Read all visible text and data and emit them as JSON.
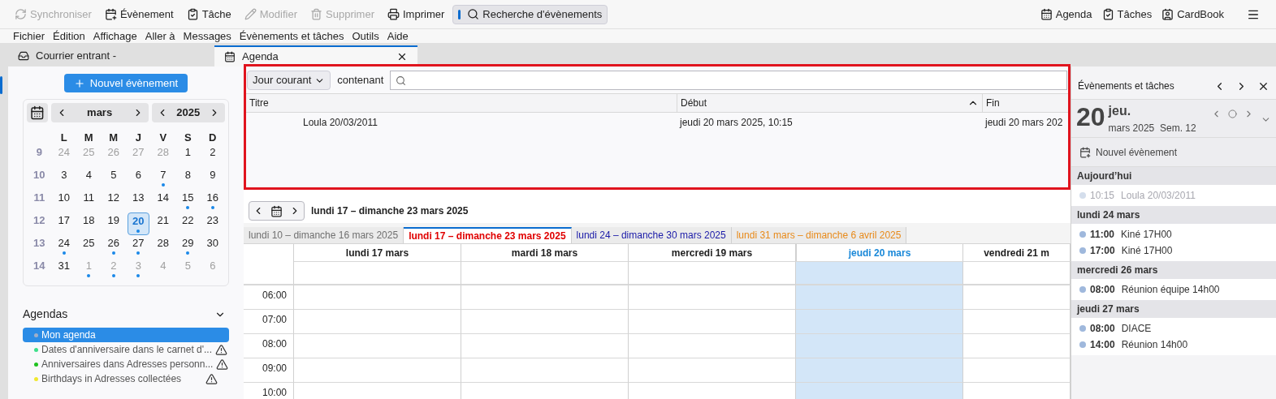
{
  "toolbar": {
    "left": [
      {
        "label": "Synchroniser",
        "disabled": true,
        "pressed": false
      },
      {
        "label": "Évènement",
        "disabled": false,
        "pressed": false
      },
      {
        "label": "Tâche",
        "disabled": false,
        "pressed": false
      },
      {
        "label": "Modifier",
        "disabled": true,
        "pressed": false
      },
      {
        "label": "Supprimer",
        "disabled": true,
        "pressed": false
      },
      {
        "label": "Imprimer",
        "disabled": false,
        "pressed": false
      },
      {
        "label": "Recherche d'évènements",
        "disabled": false,
        "pressed": true
      }
    ],
    "right": [
      {
        "label": "Agenda"
      },
      {
        "label": "Tâches"
      },
      {
        "label": "CardBook"
      }
    ]
  },
  "menu": [
    "Fichier",
    "Édition",
    "Affichage",
    "Aller à",
    "Messages",
    "Évènements et tâches",
    "Outils",
    "Aide"
  ],
  "tabs": [
    {
      "label": "Courrier entrant - ",
      "selected": false
    },
    {
      "label": "Agenda",
      "selected": true
    }
  ],
  "sidebar": {
    "new_event": "Nouvel évènement",
    "mini_calendar": {
      "month": "mars",
      "year": "2025",
      "weekdays": [
        "L",
        "M",
        "M",
        "J",
        "V",
        "S",
        "D"
      ],
      "weeks": [
        {
          "week": "9",
          "days": [
            {
              "day": "24",
              "other": true,
              "events": false,
              "selected": false
            },
            {
              "day": "25",
              "other": true,
              "events": false,
              "selected": false
            },
            {
              "day": "26",
              "other": true,
              "events": false,
              "selected": false
            },
            {
              "day": "27",
              "other": true,
              "events": false,
              "selected": false
            },
            {
              "day": "28",
              "other": true,
              "events": false,
              "selected": false
            },
            {
              "day": "1",
              "other": false,
              "events": false,
              "selected": false
            },
            {
              "day": "2",
              "other": false,
              "events": false,
              "selected": false
            }
          ]
        },
        {
          "week": "10",
          "days": [
            {
              "day": "3",
              "other": false,
              "events": false,
              "selected": false
            },
            {
              "day": "4",
              "other": false,
              "events": false,
              "selected": false
            },
            {
              "day": "5",
              "other": false,
              "events": false,
              "selected": false
            },
            {
              "day": "6",
              "other": false,
              "events": false,
              "selected": false
            },
            {
              "day": "7",
              "other": false,
              "events": true,
              "selected": false
            },
            {
              "day": "8",
              "other": false,
              "events": false,
              "selected": false
            },
            {
              "day": "9",
              "other": false,
              "events": false,
              "selected": false
            }
          ]
        },
        {
          "week": "11",
          "days": [
            {
              "day": "10",
              "other": false,
              "events": false,
              "selected": false
            },
            {
              "day": "11",
              "other": false,
              "events": false,
              "selected": false
            },
            {
              "day": "12",
              "other": false,
              "events": false,
              "selected": false
            },
            {
              "day": "13",
              "other": false,
              "events": false,
              "selected": false
            },
            {
              "day": "14",
              "other": false,
              "events": false,
              "selected": false
            },
            {
              "day": "15",
              "other": false,
              "events": true,
              "selected": false
            },
            {
              "day": "16",
              "other": false,
              "events": true,
              "selected": false
            }
          ]
        },
        {
          "week": "12",
          "days": [
            {
              "day": "17",
              "other": false,
              "events": false,
              "selected": false
            },
            {
              "day": "18",
              "other": false,
              "events": false,
              "selected": false
            },
            {
              "day": "19",
              "other": false,
              "events": false,
              "selected": false
            },
            {
              "day": "20",
              "other": false,
              "events": true,
              "selected": true
            },
            {
              "day": "21",
              "other": false,
              "events": false,
              "selected": false
            },
            {
              "day": "22",
              "other": false,
              "events": false,
              "selected": false
            },
            {
              "day": "23",
              "other": false,
              "events": false,
              "selected": false
            }
          ]
        },
        {
          "week": "13",
          "days": [
            {
              "day": "24",
              "other": false,
              "events": true,
              "selected": false
            },
            {
              "day": "25",
              "other": false,
              "events": false,
              "selected": false
            },
            {
              "day": "26",
              "other": false,
              "events": true,
              "selected": false
            },
            {
              "day": "27",
              "other": false,
              "events": true,
              "selected": false
            },
            {
              "day": "28",
              "other": false,
              "events": false,
              "selected": false
            },
            {
              "day": "29",
              "other": false,
              "events": true,
              "selected": false
            },
            {
              "day": "30",
              "other": false,
              "events": false,
              "selected": false
            }
          ]
        },
        {
          "week": "14",
          "days": [
            {
              "day": "31",
              "other": false,
              "events": false,
              "selected": false
            },
            {
              "day": "1",
              "other": true,
              "events": true,
              "selected": false
            },
            {
              "day": "2",
              "other": true,
              "events": true,
              "selected": false
            },
            {
              "day": "3",
              "other": true,
              "events": true,
              "selected": false
            },
            {
              "day": "4",
              "other": true,
              "events": false,
              "selected": false
            },
            {
              "day": "5",
              "other": true,
              "events": false,
              "selected": false
            },
            {
              "day": "6",
              "other": true,
              "events": false,
              "selected": false
            }
          ]
        }
      ]
    },
    "agendas": {
      "title": "Agendas",
      "items": [
        {
          "name": "Mon agenda",
          "color": "#a0aec8",
          "selected": true,
          "warning": false
        },
        {
          "name": "Dates d'anniversaire dans le carnet d'...",
          "color": "#3ee08a",
          "selected": false,
          "warning": true
        },
        {
          "name": "Anniversaires dans Adresses personn...",
          "color": "#1fc21f",
          "selected": false,
          "warning": true
        },
        {
          "name": "Birthdays in Adresses collectées",
          "color": "#f0e830",
          "selected": false,
          "warning": true
        }
      ]
    }
  },
  "search": {
    "filter": "Jour courant",
    "label": "contenant",
    "columns": [
      {
        "label": "Titre",
        "sorted": false
      },
      {
        "label": "Début",
        "sorted": true
      },
      {
        "label": "Fin",
        "sorted": false
      }
    ],
    "rows": [
      [
        "Loula 20/03/2011",
        "jeudi 20 mars 2025, 10:15",
        "jeudi 20 mars 202"
      ]
    ]
  },
  "week_view": {
    "title": "lundi 17 – dimanche 23 mars 2025",
    "week_tabs": [
      {
        "label": "lundi 10 – dimanche 16 mars 2025",
        "color": "#707070",
        "selected": false
      },
      {
        "label": "lundi 17 – dimanche 23 mars 2025",
        "color": "#e00000",
        "selected": true
      },
      {
        "label": "lundi 24 – dimanche 30 mars 2025",
        "color": "#1a1aa8",
        "selected": false
      },
      {
        "label": "lundi 31 mars – dimanche 6 avril 2025",
        "color": "#e88a1a",
        "selected": false
      }
    ],
    "days": [
      {
        "label": "lundi 17 mars",
        "today": false
      },
      {
        "label": "mardi 18 mars",
        "today": false
      },
      {
        "label": "mercredi 19 mars",
        "today": false
      },
      {
        "label": "jeudi 20 mars",
        "today": true
      },
      {
        "label": "vendredi 21 m",
        "today": false
      }
    ],
    "hours": [
      "06:00",
      "07:00",
      "08:00",
      "09:00",
      "10:00"
    ]
  },
  "today_pane": {
    "title": "Évènements et tâches",
    "day": "20",
    "weekday": "jeu.",
    "month_line": "mars 2025  Sem. 12",
    "new_event": "Nouvel évènement",
    "groups": [
      {
        "label": "Aujourd’hui",
        "items": [
          {
            "time": "10:15",
            "title": "Loula 20/03/2011",
            "past": true
          }
        ]
      },
      {
        "label": "lundi 24 mars",
        "items": [
          {
            "time": "11:00",
            "title": "Kiné 17H00",
            "past": false
          },
          {
            "time": "17:00",
            "title": "Kiné 17H00",
            "past": false
          }
        ]
      },
      {
        "label": "mercredi 26 mars",
        "items": [
          {
            "time": "08:00",
            "title": "Réunion équipe 14h00",
            "past": false
          }
        ]
      },
      {
        "label": "jeudi 27 mars",
        "items": [
          {
            "time": "08:00",
            "title": "DIACE",
            "past": false
          },
          {
            "time": "14:00",
            "title": "Réunion 14h00",
            "past": false
          }
        ]
      }
    ]
  }
}
